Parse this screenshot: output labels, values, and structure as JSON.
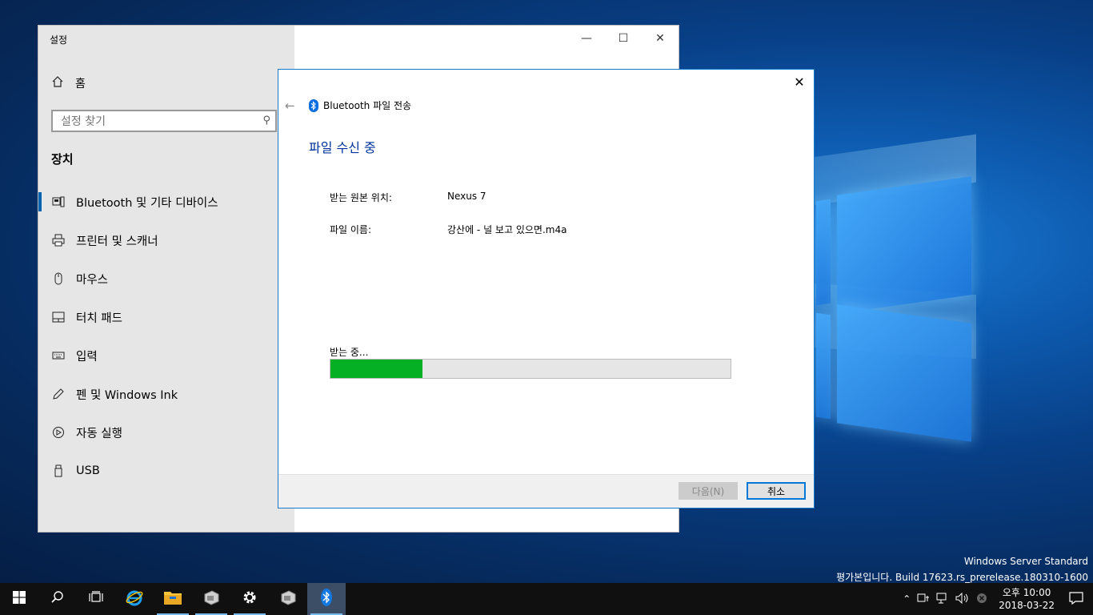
{
  "desktop": {
    "watermark_line1": "Windows Server Standard",
    "watermark_line2": "평가본입니다. Build 17623.rs_prerelease.180310-1600"
  },
  "settings": {
    "title": "설정",
    "home_label": "홈",
    "search_placeholder": "설정 찾기",
    "category": "장치",
    "items": [
      {
        "label": "Bluetooth 및 기타 디바이스",
        "icon": "bluetooth-devices-icon"
      },
      {
        "label": "프린터 및 스캐너",
        "icon": "printer-icon"
      },
      {
        "label": "마우스",
        "icon": "mouse-icon"
      },
      {
        "label": "터치 패드",
        "icon": "touchpad-icon"
      },
      {
        "label": "입력",
        "icon": "keyboard-icon"
      },
      {
        "label": "펜 및 Windows Ink",
        "icon": "pen-icon"
      },
      {
        "label": "자동 실행",
        "icon": "autoplay-icon"
      },
      {
        "label": "USB",
        "icon": "usb-icon"
      }
    ]
  },
  "dialog": {
    "title": "Bluetooth 파일 전송",
    "heading": "파일 수신 중",
    "source_label": "받는 원본 위치:",
    "source_value": "Nexus 7",
    "filename_label": "파일 이름:",
    "filename_value": "강산에 - 널 보고 있으면.m4a",
    "status": "받는 중...",
    "progress_percent": 23,
    "next_label": "다음(N)",
    "cancel_label": "취소"
  },
  "taskbar": {
    "clock_time": "오후 10:00",
    "clock_date": "2018-03-22"
  },
  "colors": {
    "accent": "#0078d7",
    "progress": "#06b025",
    "heading": "#003399"
  }
}
